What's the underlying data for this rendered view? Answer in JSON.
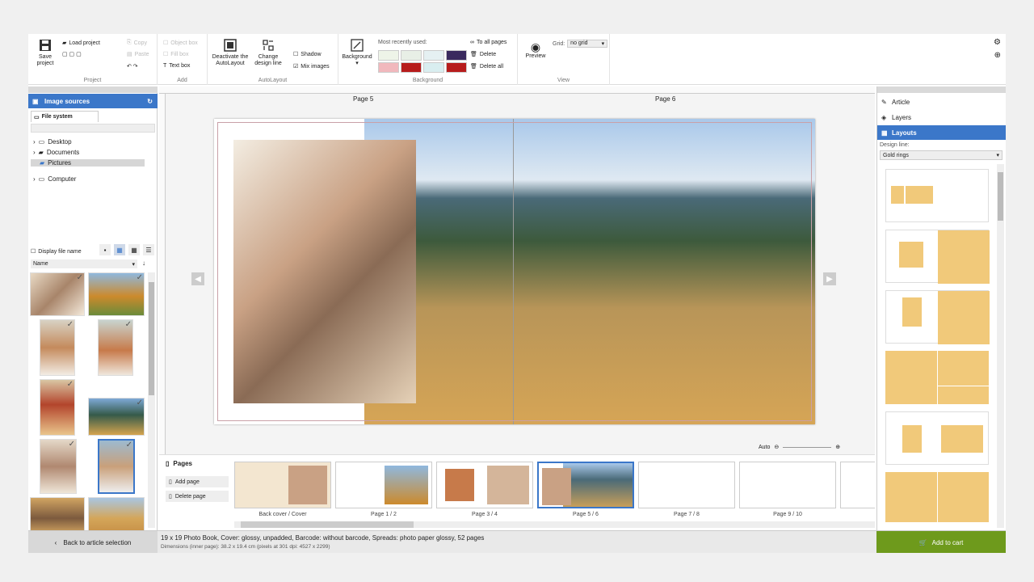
{
  "ribbon": {
    "project": {
      "save": "Save project",
      "load": "Load project",
      "copy": "Copy",
      "paste": "Paste",
      "group": "Project"
    },
    "add": {
      "object_box": "Object box",
      "fill_box": "Fill box",
      "text_box": "Text box",
      "group": "Add"
    },
    "autolayout": {
      "deactivate": "Deactivate the AutoLayout",
      "change": "Change design line",
      "shadow": "Shadow",
      "mix": "Mix images",
      "group": "AutoLayout"
    },
    "background": {
      "label": "Background",
      "recent": "Most recently used:",
      "to_all": "To all pages",
      "delete": "Delete",
      "delete_all": "Delete all",
      "group": "Background"
    },
    "view": {
      "preview": "Preview",
      "grid_label": "Grid:",
      "grid_value": "no grid",
      "group": "View"
    }
  },
  "left": {
    "title": "Image sources",
    "tab": "File system",
    "tree": [
      "Desktop",
      "Documents",
      "Pictures",
      "Computer"
    ],
    "display_file_name": "Display file name",
    "sort": "Name"
  },
  "main": {
    "page_left": "Page 5",
    "page_right": "Page 6",
    "zoom": "Auto"
  },
  "pages_panel": {
    "title": "Pages",
    "add": "Add page",
    "delete": "Delete page",
    "items": [
      "Back cover / Cover",
      "Page 1 / 2",
      "Page 3 / 4",
      "Page 5 / 6",
      "Page 7 / 8",
      "Page 9 / 10"
    ]
  },
  "right": {
    "article": "Article",
    "layers": "Layers",
    "layouts": "Layouts",
    "design_line_label": "Design line:",
    "design_line_value": "Gold rings"
  },
  "status": {
    "back": "Back to article selection",
    "line1": "19 x 19 Photo Book, Cover: glossy, unpadded, Barcode: without barcode, Spreads: photo paper glossy, 52 pages",
    "line2": "Dimensions (inner page): 38.2 x 19.4 cm (pixels at 301 dpi: 4527 x 2299)",
    "cart": "Add to cart"
  },
  "colors": {
    "accent": "#3b77c9",
    "cart": "#6e9a1c",
    "gold": "#f1c97a"
  }
}
